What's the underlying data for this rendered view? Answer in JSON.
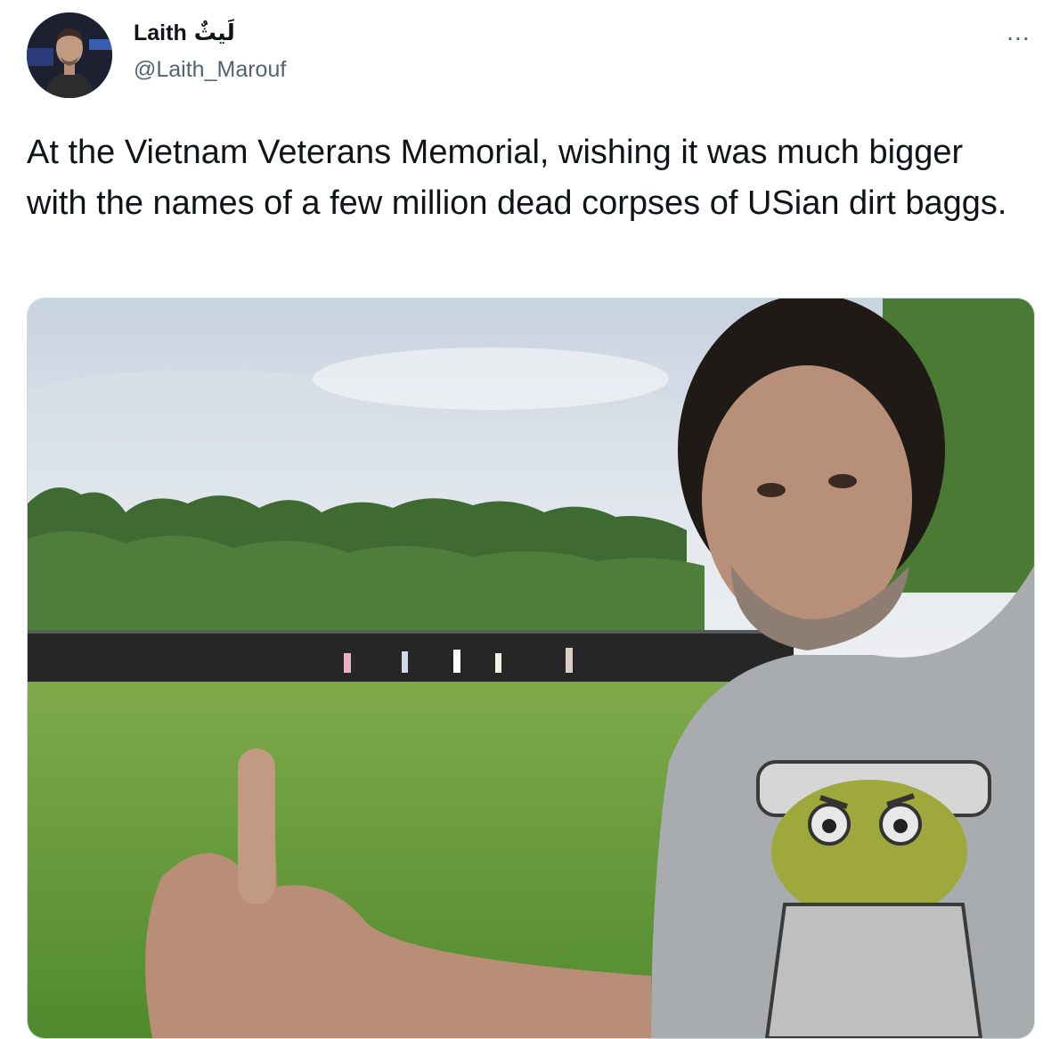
{
  "author": {
    "display_name": "Laith",
    "display_name_ar": "لَيثٌ",
    "handle": "@Laith_Marouf",
    "avatar_icon": "profile-photo"
  },
  "more_icon": "…",
  "tweet": {
    "text": "At the Vietnam Veterans Memorial, wishing it was much bigger with the names of a few million dead corpses of USian dirt baggs."
  },
  "media": {
    "description_icon": "photo"
  }
}
